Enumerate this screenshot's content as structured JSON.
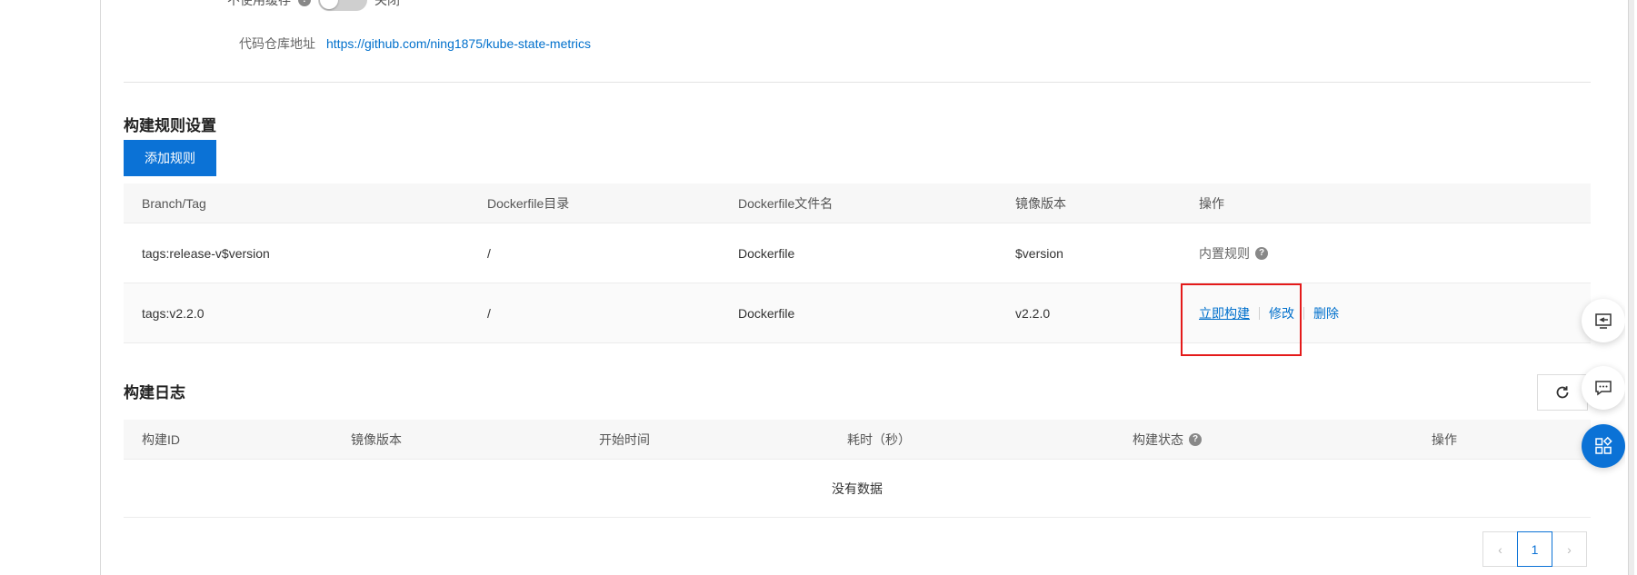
{
  "partial_setting": {
    "label": "不使用缓存",
    "toggle_text": "关闭"
  },
  "repo": {
    "label": "代码仓库地址",
    "url": "https://github.com/ning1875/kube-state-metrics"
  },
  "build_rules": {
    "title": "构建规则设置",
    "add_button": "添加规则",
    "columns": [
      "Branch/Tag",
      "Dockerfile目录",
      "Dockerfile文件名",
      "镜像版本",
      "操作"
    ],
    "rows": [
      {
        "branch_tag": "tags:release-v$version",
        "dir": "/",
        "filename": "Dockerfile",
        "version": "$version",
        "builtin_label": "内置规则"
      },
      {
        "branch_tag": "tags:v2.2.0",
        "dir": "/",
        "filename": "Dockerfile",
        "version": "v2.2.0",
        "actions": [
          "立即构建",
          "修改",
          "删除"
        ]
      }
    ]
  },
  "build_logs": {
    "title": "构建日志",
    "columns": [
      "构建ID",
      "镜像版本",
      "开始时间",
      "耗时（秒）",
      "构建状态",
      "操作"
    ],
    "empty_text": "没有数据"
  },
  "pagination": {
    "current_page": "1"
  },
  "colors": {
    "primary": "#0b72d6",
    "link": "#0070cc",
    "highlight": "#e41a1a"
  }
}
